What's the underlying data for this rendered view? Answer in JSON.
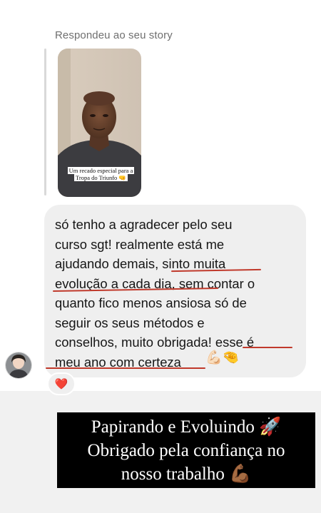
{
  "reply": {
    "label": "Respondeu ao seu story"
  },
  "story": {
    "caption": "Um recado especial para a Tropa do Triunfo 🤜"
  },
  "message": {
    "text": "só tenho a agradecer pelo seu\ncurso sgt! realmente está me\najudando demais, sinto muita\nevolução a cada dia, sem contar o\nquanto fico menos ansiosa só de\nseguir os seus métodos e\nconselhos, muito obrigada! esse é\nmeu ano com certeza",
    "trailing_emojis": "💪🏻🤏",
    "underline_color": "#c0392b"
  },
  "reaction": {
    "emoji": "❤️"
  },
  "overlay": {
    "line1": "Papirando e Evoluindo 🚀",
    "line2": "Obrigado pela confiança no",
    "line3": "nosso trabalho 💪🏾"
  }
}
